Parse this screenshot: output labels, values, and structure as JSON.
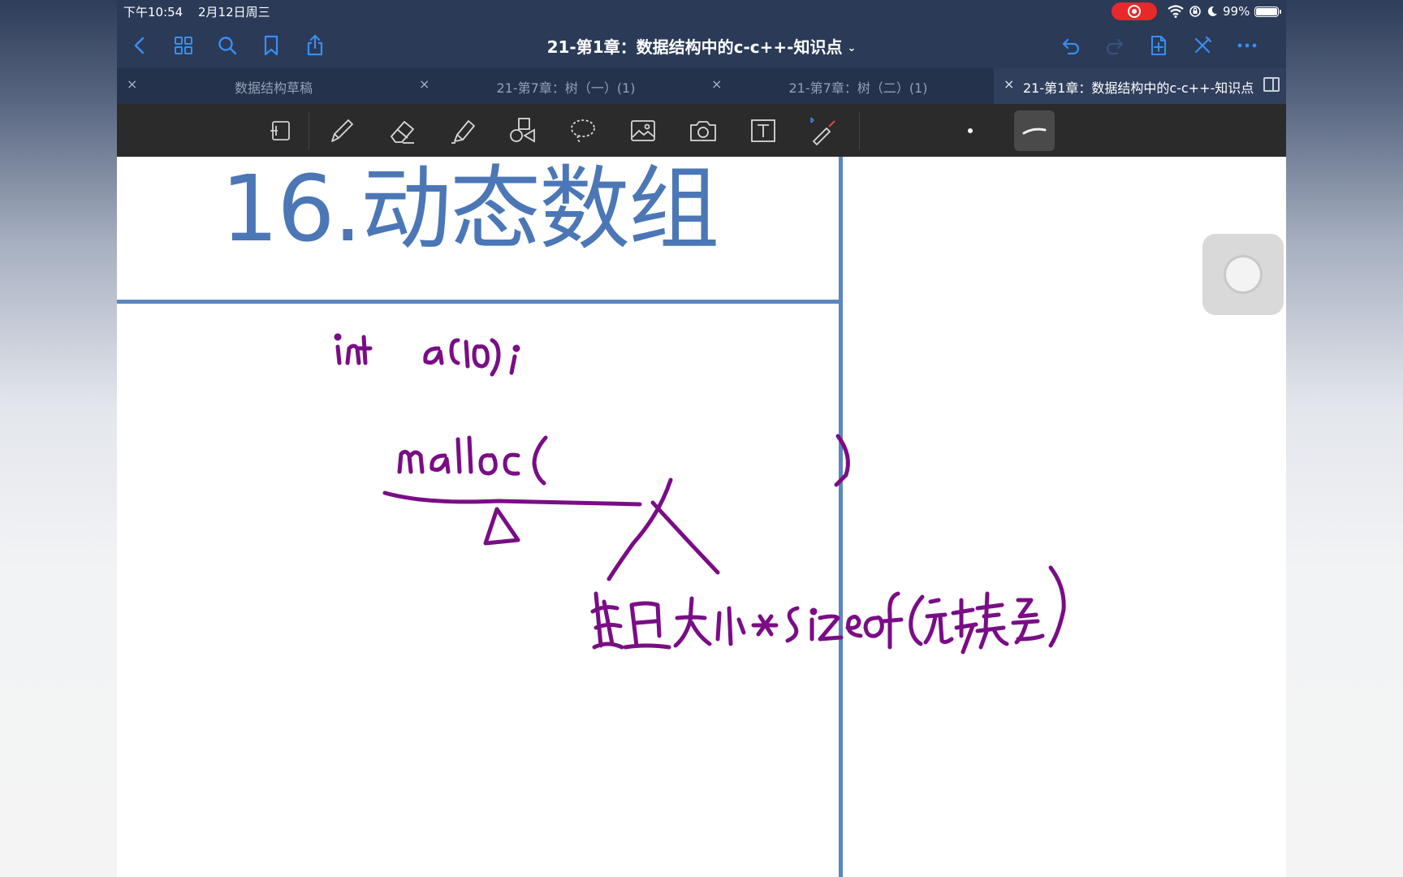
{
  "status_bar": {
    "time": "下午10:54",
    "date": "2月12日周三",
    "battery": "99%",
    "battery_level": 0.99
  },
  "nav": {
    "title": "21-第1章：数据结构中的c-c++-知识点",
    "title_chevron": "⌄",
    "left_icons": [
      "back-icon",
      "grid-icon",
      "search-icon",
      "bookmark-icon",
      "share-icon"
    ],
    "right_icons": [
      "undo-icon",
      "redo-icon",
      "add-page-icon",
      "close-edit-icon",
      "more-icon"
    ]
  },
  "tabs": [
    {
      "label": "数据结构草稿",
      "close": "×",
      "active": false
    },
    {
      "label": "21-第7章：树（一）(1)",
      "close": "×",
      "active": false
    },
    {
      "label": "21-第7章：树（二）(1)",
      "close": "×",
      "active": false
    },
    {
      "label": "21-第1章：数据结构中的c-c++-知识点",
      "close": "×",
      "active": true
    }
  ],
  "toolbar": {
    "tools": [
      "scan-icon",
      "pen-icon",
      "eraser-icon",
      "highlighter-icon",
      "shapes-icon",
      "lasso-icon",
      "image-icon",
      "camera-icon",
      "text-icon",
      "laser-pointer-icon"
    ]
  },
  "page": {
    "title": "16.动态数组"
  },
  "colors": {
    "title_blue": "#4b77b6",
    "line_blue": "#5b86c0",
    "ink_purple": "#7a0d86",
    "nav_bg": "#2a3a57",
    "toolbar_bg": "#2b2b2b"
  }
}
